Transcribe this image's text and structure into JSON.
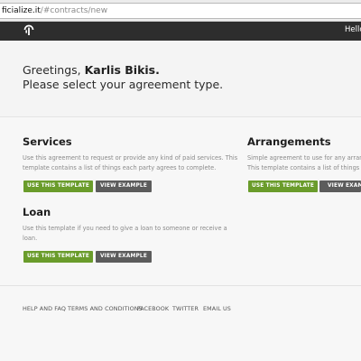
{
  "browser": {
    "url_host": "ficialize.it",
    "url_path": "/#contracts/new"
  },
  "nav": {
    "greeting": "Hello,"
  },
  "hero": {
    "greeting_prefix": "Greetings, ",
    "user_name": "Karlis Bikis.",
    "subtitle": "Please select your agreement type."
  },
  "cards": {
    "services": {
      "title": "Services",
      "desc_line1": "Use this agreement to request or provide any kind of paid services. This",
      "desc_line2": "template contains a list of things each party agrees to complete.",
      "use_label": "USE THIS TEMPLATE",
      "view_label": "VIEW EXAMPLE"
    },
    "arrangements": {
      "title": "Arrangements",
      "desc_line1": "Simple agreement to use for any arrange",
      "desc_line2": "This template contains a list of things each",
      "use_label": "USE THIS TEMPLATE",
      "view_label": "VIEW EXAMPLE"
    },
    "loan": {
      "title": "Loan",
      "desc_line1": "Use this template if you need to give a loan to someone or receive a",
      "desc_line2": "loan.",
      "use_label": "USE THIS TEMPLATE",
      "view_label": "VIEW EXAMPLE"
    }
  },
  "footer": {
    "links": [
      "HELP AND FAQ",
      "TERMS AND CONDITIONS",
      "FACEBOOK",
      "TWITTER",
      "EMAIL US"
    ]
  },
  "colors": {
    "nav_bg": "#2d2d2d",
    "primary_button": "#6a9c2b",
    "secondary_button": "#5c5c5c"
  }
}
